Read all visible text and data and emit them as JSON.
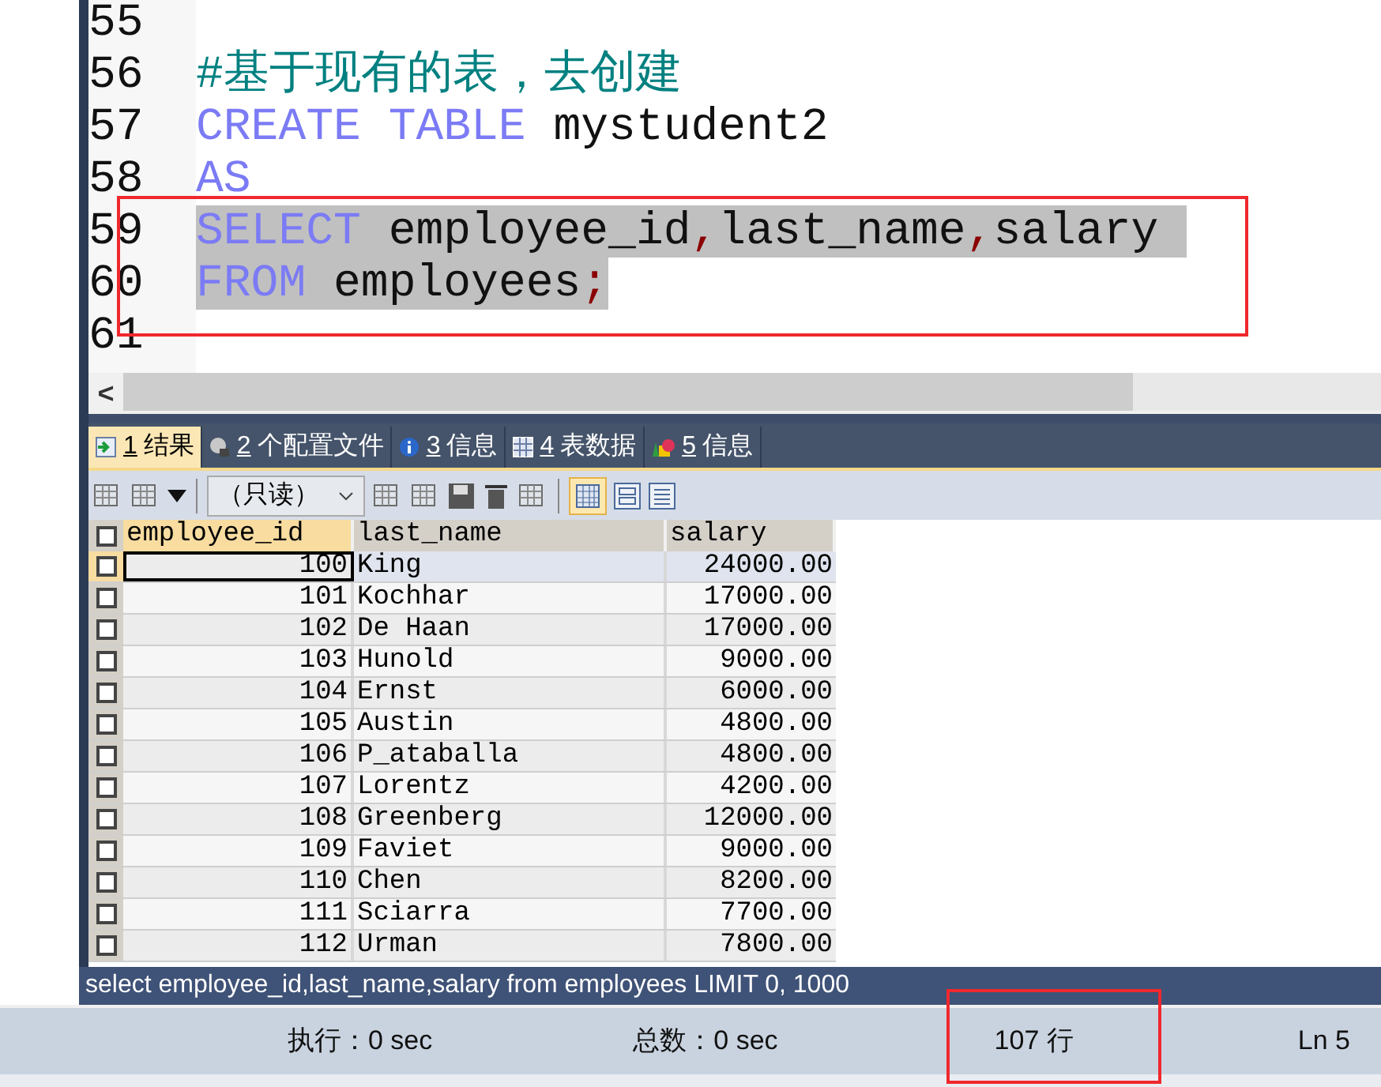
{
  "editor": {
    "lines": [
      {
        "number": "55"
      },
      {
        "number": "56",
        "selected": false,
        "tokens": [
          {
            "kind": "comment",
            "text": "#基于现有的表，去创建"
          }
        ]
      },
      {
        "number": "57",
        "selected": false,
        "tokens": [
          {
            "kind": "keyword",
            "text": "CREATE TABLE"
          },
          {
            "kind": "ident",
            "text": " mystudent2"
          }
        ]
      },
      {
        "number": "58",
        "selected": false,
        "tokens": [
          {
            "kind": "keyword",
            "text": "AS"
          }
        ]
      },
      {
        "number": "59",
        "selected": true,
        "tokens": [
          {
            "kind": "keyword",
            "text": "SELECT"
          },
          {
            "kind": "ident",
            "text": " employee_id"
          },
          {
            "kind": "punct",
            "text": ","
          },
          {
            "kind": "ident",
            "text": "last_name"
          },
          {
            "kind": "punct",
            "text": ","
          },
          {
            "kind": "ident",
            "text": "salary "
          }
        ]
      },
      {
        "number": "60",
        "selected": true,
        "tokens": [
          {
            "kind": "keyword",
            "text": "FROM"
          },
          {
            "kind": "ident",
            "text": " employees"
          },
          {
            "kind": "punct",
            "text": ";"
          }
        ]
      },
      {
        "number": "61"
      }
    ]
  },
  "scrollbar_button": "<",
  "tabs": [
    {
      "number": "1",
      "label": "结果",
      "selected": true,
      "kind": "grid"
    },
    {
      "number": "2",
      "label": "个配置文件",
      "selected": false,
      "kind": "profile"
    },
    {
      "number": "3",
      "label": "信息",
      "selected": false,
      "kind": "info"
    },
    {
      "number": "4",
      "label": "表数据",
      "selected": false,
      "kind": "table"
    },
    {
      "number": "5",
      "label": "信息",
      "selected": false,
      "kind": "shapes"
    }
  ],
  "toolbar": {
    "mode_select": "（只读）"
  },
  "table": {
    "all_checked": false,
    "columns": [
      "employee_id",
      "last_name",
      "salary"
    ],
    "rows": [
      {
        "employee_id": "100",
        "last_name": "King",
        "salary": "24000.00",
        "selected": true,
        "checked": false
      },
      {
        "employee_id": "101",
        "last_name": "Kochhar",
        "salary": "17000.00",
        "selected": false,
        "checked": false
      },
      {
        "employee_id": "102",
        "last_name": "De Haan",
        "salary": "17000.00",
        "selected": false,
        "checked": false
      },
      {
        "employee_id": "103",
        "last_name": "Hunold",
        "salary": "9000.00",
        "selected": false,
        "checked": false
      },
      {
        "employee_id": "104",
        "last_name": "Ernst",
        "salary": "6000.00",
        "selected": false,
        "checked": false
      },
      {
        "employee_id": "105",
        "last_name": "Austin",
        "salary": "4800.00",
        "selected": false,
        "checked": false
      },
      {
        "employee_id": "106",
        "last_name": "P_ataballa",
        "salary": "4800.00",
        "selected": false,
        "checked": false
      },
      {
        "employee_id": "107",
        "last_name": "Lorentz",
        "salary": "4200.00",
        "selected": false,
        "checked": false
      },
      {
        "employee_id": "108",
        "last_name": "Greenberg",
        "salary": "12000.00",
        "selected": false,
        "checked": false
      },
      {
        "employee_id": "109",
        "last_name": "Faviet",
        "salary": "9000.00",
        "selected": false,
        "checked": false
      },
      {
        "employee_id": "110",
        "last_name": "Chen",
        "salary": "8200.00",
        "selected": false,
        "checked": false
      },
      {
        "employee_id": "111",
        "last_name": "Sciarra",
        "salary": "7700.00",
        "selected": false,
        "checked": false
      },
      {
        "employee_id": "112",
        "last_name": "Urman",
        "salary": "7800.00",
        "selected": false,
        "checked": false
      }
    ]
  },
  "query_bar": "select employee_id,last_name,salary from employees LIMIT 0, 1000",
  "status_bar": {
    "exec_time": "执行：0 sec",
    "total_time": "总数：0 sec",
    "row_count": "107 行",
    "cursor": "Ln 5"
  }
}
